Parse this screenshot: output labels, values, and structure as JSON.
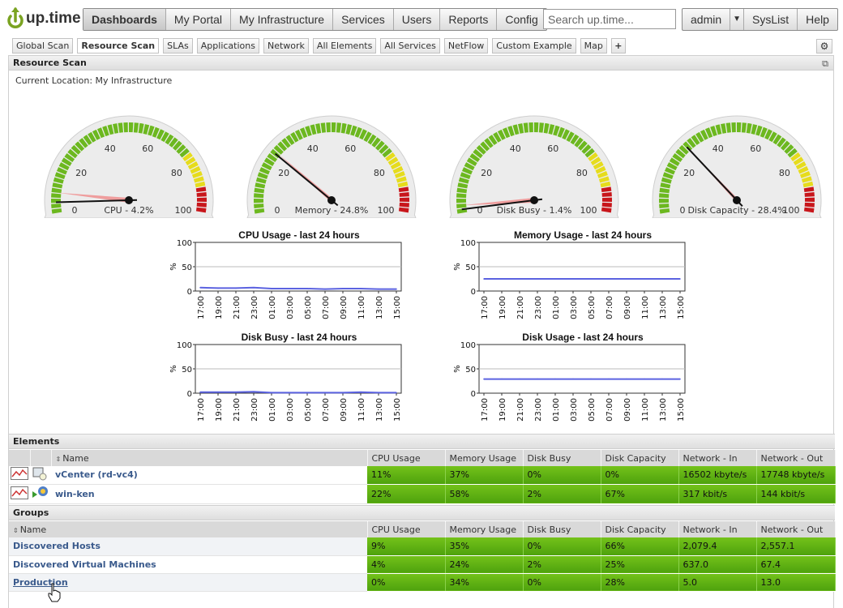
{
  "app": {
    "logo_text": "up.time"
  },
  "nav": {
    "items": [
      "Dashboards",
      "My Portal",
      "My Infrastructure",
      "Services",
      "Users",
      "Reports",
      "Config"
    ],
    "active": "Dashboards"
  },
  "search": {
    "placeholder": "Search up.time..."
  },
  "user_nav": {
    "user": "admin",
    "items": [
      "SysList",
      "Help"
    ]
  },
  "tabs": {
    "items": [
      "Global Scan",
      "Resource Scan",
      "SLAs",
      "Applications",
      "Network",
      "All Elements",
      "All Services",
      "NetFlow",
      "Custom Example",
      "Map"
    ],
    "active": "Resource Scan",
    "add": "+"
  },
  "panel": {
    "title": "Resource Scan",
    "location": "Current Location: My Infrastructure"
  },
  "gauges": [
    {
      "label": "CPU - 4.2%",
      "value": 4.2,
      "peak": 8
    },
    {
      "label": "Memory - 24.8%",
      "value": 24.8,
      "peak": 25.5
    },
    {
      "label": "Disk Busy - 1.4%",
      "value": 1.4,
      "peak": 3
    },
    {
      "label": "Disk Capacity - 28.4%",
      "value": 28.4,
      "peak": 28.4
    }
  ],
  "gauge_ticks": [
    "0",
    "20",
    "40",
    "60",
    "80",
    "100"
  ],
  "colors": {
    "gauge_green": "#6cb81f",
    "gauge_yellow": "#e6dc1c",
    "gauge_red": "#c8161b",
    "metric_green": "#5fae13",
    "line_blue": "#5b62e0"
  },
  "chart_data": [
    {
      "type": "line",
      "title": "CPU Usage - last 24 hours",
      "ylabel": "%",
      "ylim": [
        0,
        100
      ],
      "yticks": [
        "100",
        "50",
        "0"
      ],
      "categories": [
        "17:00",
        "19:00",
        "21:00",
        "23:00",
        "01:00",
        "03:00",
        "05:00",
        "07:00",
        "09:00",
        "11:00",
        "13:00",
        "15:00"
      ],
      "values": [
        7,
        6,
        6,
        7,
        5,
        5,
        5,
        4,
        5,
        5,
        4,
        4
      ],
      "grid": true
    },
    {
      "type": "line",
      "title": "Memory Usage - last 24 hours",
      "ylabel": "%",
      "ylim": [
        0,
        100
      ],
      "yticks": [
        "100",
        "50",
        "0"
      ],
      "categories": [
        "17:00",
        "19:00",
        "21:00",
        "23:00",
        "01:00",
        "03:00",
        "05:00",
        "07:00",
        "09:00",
        "11:00",
        "13:00",
        "15:00"
      ],
      "values": [
        25,
        25,
        25,
        25,
        25,
        25,
        25,
        25,
        25,
        25,
        25,
        25
      ],
      "grid": true
    },
    {
      "type": "line",
      "title": "Disk Busy - last 24 hours",
      "ylabel": "%",
      "ylim": [
        0,
        100
      ],
      "yticks": [
        "100",
        "50",
        "0"
      ],
      "categories": [
        "17:00",
        "19:00",
        "21:00",
        "23:00",
        "01:00",
        "03:00",
        "05:00",
        "07:00",
        "09:00",
        "11:00",
        "13:00",
        "15:00"
      ],
      "values": [
        2,
        2,
        2,
        3,
        1,
        1,
        1,
        1,
        1,
        2,
        1,
        1
      ],
      "grid": true
    },
    {
      "type": "line",
      "title": "Disk Usage - last 24 hours",
      "ylabel": "%",
      "ylim": [
        0,
        100
      ],
      "yticks": [
        "100",
        "50",
        "0"
      ],
      "categories": [
        "17:00",
        "19:00",
        "21:00",
        "23:00",
        "01:00",
        "03:00",
        "05:00",
        "07:00",
        "09:00",
        "11:00",
        "13:00",
        "15:00"
      ],
      "values": [
        29,
        29,
        29,
        29,
        29,
        29,
        29,
        29,
        29,
        29,
        29,
        29
      ],
      "grid": true
    }
  ],
  "elements": {
    "title": "Elements",
    "columns": [
      "Name",
      "CPU Usage",
      "Memory Usage",
      "Disk Busy",
      "Disk Capacity",
      "Network - In",
      "Network - Out"
    ],
    "rows": [
      {
        "name": "vCenter (rd-vc4)",
        "cpu": "11%",
        "mem": "37%",
        "disk_busy": "0%",
        "disk_cap": "0%",
        "net_in": "16502 kbyte/s",
        "net_out": "17748 kbyte/s"
      },
      {
        "name": "win-ken",
        "cpu": "22%",
        "mem": "58%",
        "disk_busy": "2%",
        "disk_cap": "67%",
        "net_in": "317 kbit/s",
        "net_out": "144 kbit/s"
      }
    ]
  },
  "groups": {
    "title": "Groups",
    "columns": [
      "Name",
      "CPU Usage",
      "Memory Usage",
      "Disk Busy",
      "Disk Capacity",
      "Network - In",
      "Network - Out"
    ],
    "rows": [
      {
        "name": "Discovered Hosts",
        "cpu": "9%",
        "mem": "35%",
        "disk_busy": "0%",
        "disk_cap": "66%",
        "net_in": "2,079.4",
        "net_out": "2,557.1"
      },
      {
        "name": "Discovered Virtual Machines",
        "cpu": "4%",
        "mem": "24%",
        "disk_busy": "2%",
        "disk_cap": "25%",
        "net_in": "637.0",
        "net_out": "67.4"
      },
      {
        "name": "Production",
        "cpu": "0%",
        "mem": "34%",
        "disk_busy": "0%",
        "disk_cap": "28%",
        "net_in": "5.0",
        "net_out": "13.0"
      }
    ]
  }
}
